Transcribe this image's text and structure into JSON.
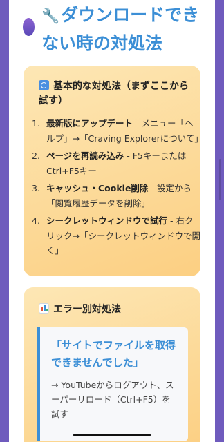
{
  "page": {
    "title": "ダウンロードできない時の対処法",
    "title_icon": "🔧"
  },
  "basic_card": {
    "icon": "refresh-icon",
    "heading": "基本的な対処法（まずここから試す）",
    "steps": [
      {
        "num": "1.",
        "bold": "最新版にアップデート",
        "text": " - メニュー「ヘルプ」→「Craving Explorerについて」"
      },
      {
        "num": "2.",
        "bold": "ページを再読み込み",
        "text": " - F5キーまたはCtrl+F5キー"
      },
      {
        "num": "3.",
        "bold": "キャッシュ・Cookie削除",
        "text": " - 設定から「閲覧履歴データを削除」"
      },
      {
        "num": "4.",
        "bold": "シークレットウィンドウで試行",
        "text": " - 右クリック→「シークレットウィンドウで開く」"
      }
    ]
  },
  "error_card": {
    "icon": "bar-chart-icon",
    "heading": "エラー別対処法",
    "note": {
      "title": "「サイトでファイルを取得できませんでした」",
      "body": "→ YouTubeからログアウト、スーパーリロード（Ctrl+F5）を試す"
    }
  },
  "colors": {
    "accent": "#3c8fd6",
    "card": "#fcd38e",
    "frame": "#6f5bbd"
  }
}
